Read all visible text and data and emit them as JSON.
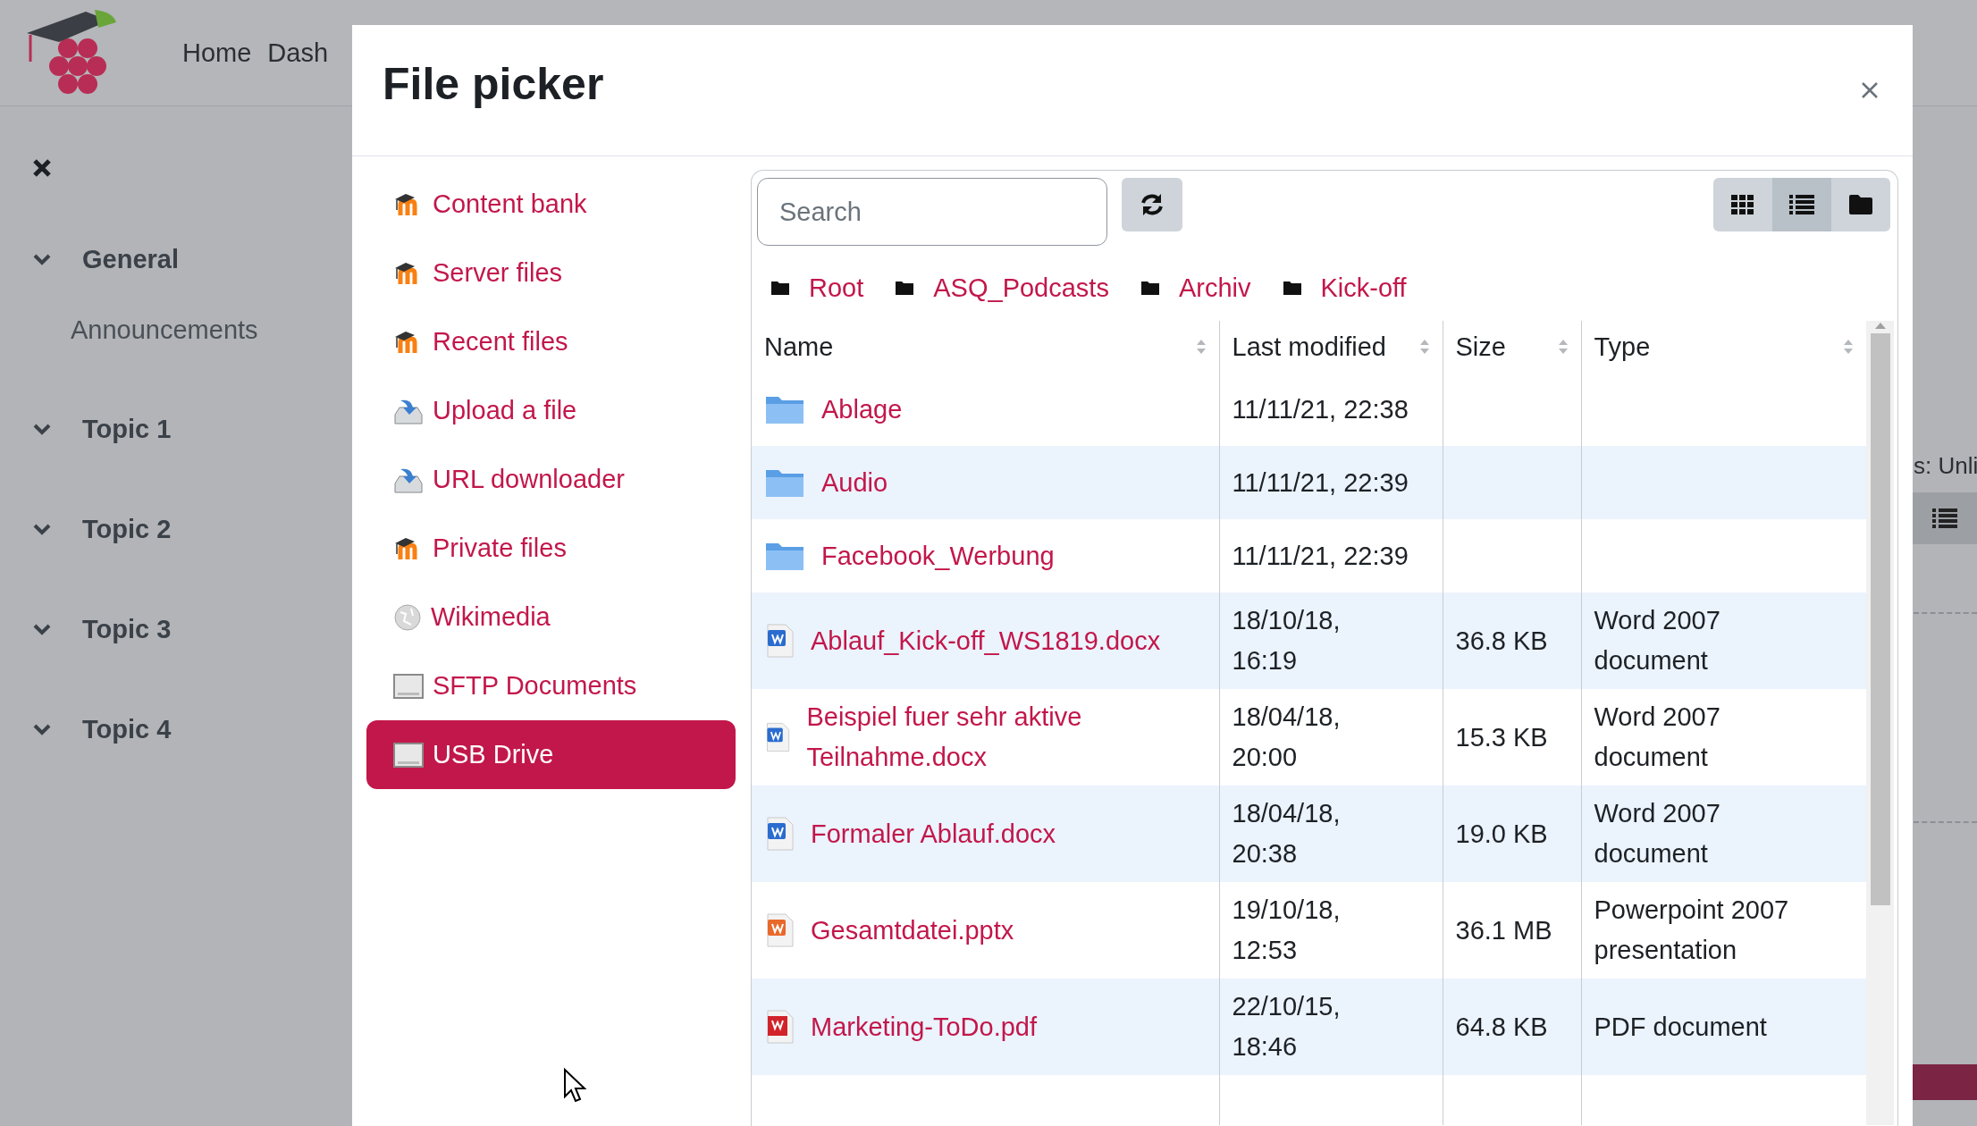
{
  "topbar": {
    "nav": [
      "Home",
      "Dash"
    ]
  },
  "drawer": {
    "sections": [
      {
        "title": "General",
        "expanded": true,
        "children": [
          "Announcements"
        ]
      },
      {
        "title": "Topic 1",
        "expanded": true
      },
      {
        "title": "Topic 2",
        "expanded": true
      },
      {
        "title": "Topic 3",
        "expanded": true
      },
      {
        "title": "Topic 4",
        "expanded": true
      }
    ]
  },
  "background_content": {
    "text": "s: Unli"
  },
  "modal": {
    "title": "File picker",
    "repositories": [
      {
        "label": "Content bank",
        "kind": "moodle",
        "selected": false
      },
      {
        "label": "Server files",
        "kind": "moodle",
        "selected": false
      },
      {
        "label": "Recent files",
        "kind": "moodle",
        "selected": false
      },
      {
        "label": "Upload a file",
        "kind": "upload",
        "selected": false
      },
      {
        "label": "URL downloader",
        "kind": "upload",
        "selected": false
      },
      {
        "label": "Private files",
        "kind": "moodle",
        "selected": false
      },
      {
        "label": "Wikimedia",
        "kind": "globe",
        "selected": false
      },
      {
        "label": "SFTP Documents",
        "kind": "drive",
        "selected": false
      },
      {
        "label": "USB Drive",
        "kind": "drive",
        "selected": true
      }
    ],
    "search": {
      "placeholder": "Search"
    },
    "view_modes": [
      {
        "kind": "grid",
        "selected": false
      },
      {
        "kind": "list",
        "selected": true
      },
      {
        "kind": "folder",
        "selected": false
      }
    ],
    "breadcrumb": [
      "Root",
      "ASQ_Podcasts",
      "Archiv",
      "Kick-off"
    ],
    "table": {
      "columns": [
        "Name",
        "Last modified",
        "Size",
        "Type"
      ],
      "rows": [
        {
          "kind": "folder",
          "name": "Ablage",
          "modified": "11/11/21, 22:38"
        },
        {
          "kind": "folder",
          "name": "Audio",
          "modified": "11/11/21, 22:39"
        },
        {
          "kind": "folder",
          "name": "Facebook_Werbung",
          "modified": "11/11/21, 22:39"
        },
        {
          "kind": "word",
          "name": "Ablauf_Kick-off_WS1819.docx",
          "modified": "18/10/18, 16:19",
          "size": "36.8 KB",
          "type": "Word 2007 document"
        },
        {
          "kind": "word",
          "name": "Beispiel fuer sehr aktive Teilnahme.docx",
          "modified": "18/04/18, 20:00",
          "size": "15.3 KB",
          "type": "Word 2007 document"
        },
        {
          "kind": "word",
          "name": "Formaler Ablauf.docx",
          "modified": "18/04/18, 20:38",
          "size": "19.0 KB",
          "type": "Word 2007 document"
        },
        {
          "kind": "powerpoint",
          "name": "Gesamtdatei.pptx",
          "modified": "19/10/18, 12:53",
          "size": "36.1 MB",
          "type": "Powerpoint 2007 presentation"
        },
        {
          "kind": "pdf",
          "name": "Marketing-ToDo.pdf",
          "modified": "22/10/15, 18:46",
          "size": "64.8 KB",
          "type": "PDF document"
        }
      ]
    }
  }
}
